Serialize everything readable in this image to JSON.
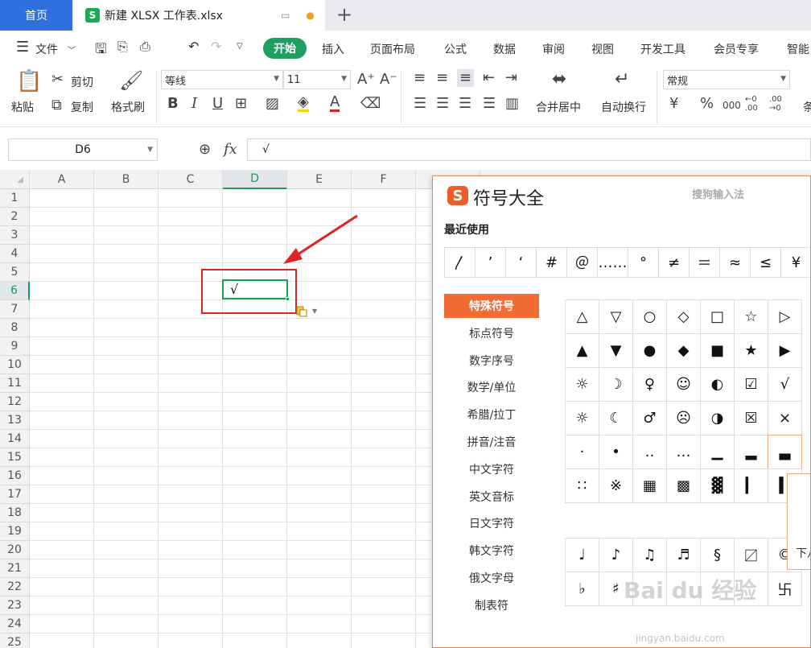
{
  "tabs": {
    "home_label": "首页",
    "file_label": "新建 XLSX 工作表.xlsx",
    "file_icon": "S",
    "add_label": "+"
  },
  "menu": {
    "file": "文件",
    "items": [
      "开始",
      "插入",
      "页面布局",
      "公式",
      "数据",
      "审阅",
      "视图",
      "开发工具",
      "会员专享",
      "智能"
    ]
  },
  "ribbon": {
    "paste": "粘贴",
    "cut": "剪切",
    "copy": "复制",
    "format_painter": "格式刷",
    "font_name": "等线",
    "font_size": "11",
    "merge_center": "合并居中",
    "wrap_text": "自动换行",
    "number_format": "常规",
    "currency": "¥",
    "percent": "%",
    "thousands": "000",
    "dec_inc": "←0 .00",
    "dec_dec": ".00 →0",
    "more": "条"
  },
  "formula_bar": {
    "name_box": "D6",
    "fx": "fx",
    "value": "√"
  },
  "grid": {
    "columns": [
      "A",
      "B",
      "C",
      "D",
      "E",
      "F"
    ],
    "rows": [
      "1",
      "2",
      "3",
      "4",
      "5",
      "6",
      "7",
      "8",
      "9",
      "10",
      "11",
      "12",
      "13",
      "14",
      "15",
      "16",
      "17",
      "18",
      "19",
      "20",
      "21",
      "22",
      "23",
      "24",
      "25"
    ],
    "active_cell_value": "√"
  },
  "symbol_panel": {
    "logo": "S",
    "title": "符号大全",
    "brand": "搜狗输入法",
    "recent_label": "最近使用",
    "recent": [
      "〳",
      "’",
      "‘",
      "#",
      "＠",
      "……",
      "°",
      "≠",
      "＝",
      "≈",
      "≤",
      "¥"
    ],
    "categories": [
      "特殊符号",
      "标点符号",
      "数字序号",
      "数学/单位",
      "希腊/拉丁",
      "拼音/注音",
      "中文字符",
      "英文音标",
      "日文字符",
      "韩文字符",
      "俄文字母",
      "制表符"
    ],
    "symbols": [
      [
        "△",
        "▽",
        "○",
        "◇",
        "□",
        "☆",
        "▷"
      ],
      [
        "▲",
        "▼",
        "●",
        "◆",
        "■",
        "★",
        "▶"
      ],
      [
        "☼",
        "☽",
        "♀",
        "☺",
        "◐",
        "☑",
        "√"
      ],
      [
        "☼",
        "☾",
        "♂",
        "☹",
        "◑",
        "☒",
        "×"
      ],
      [
        "·",
        "•",
        "‥",
        "…",
        "▁",
        "▂",
        "▃"
      ],
      [
        "∷",
        "※",
        "▦",
        "▩",
        "▓",
        "▎",
        "▍"
      ]
    ],
    "symbols2": [
      [
        "♩",
        "♪",
        "♫",
        "♬",
        "§",
        "〼",
        "©"
      ],
      [
        "♭",
        "♯",
        "",
        "",
        "",
        "",
        "卐"
      ]
    ],
    "preview_text": "下八"
  },
  "watermark": {
    "logo": "Bai du 经验",
    "url": "jingyan.baidu.com"
  }
}
